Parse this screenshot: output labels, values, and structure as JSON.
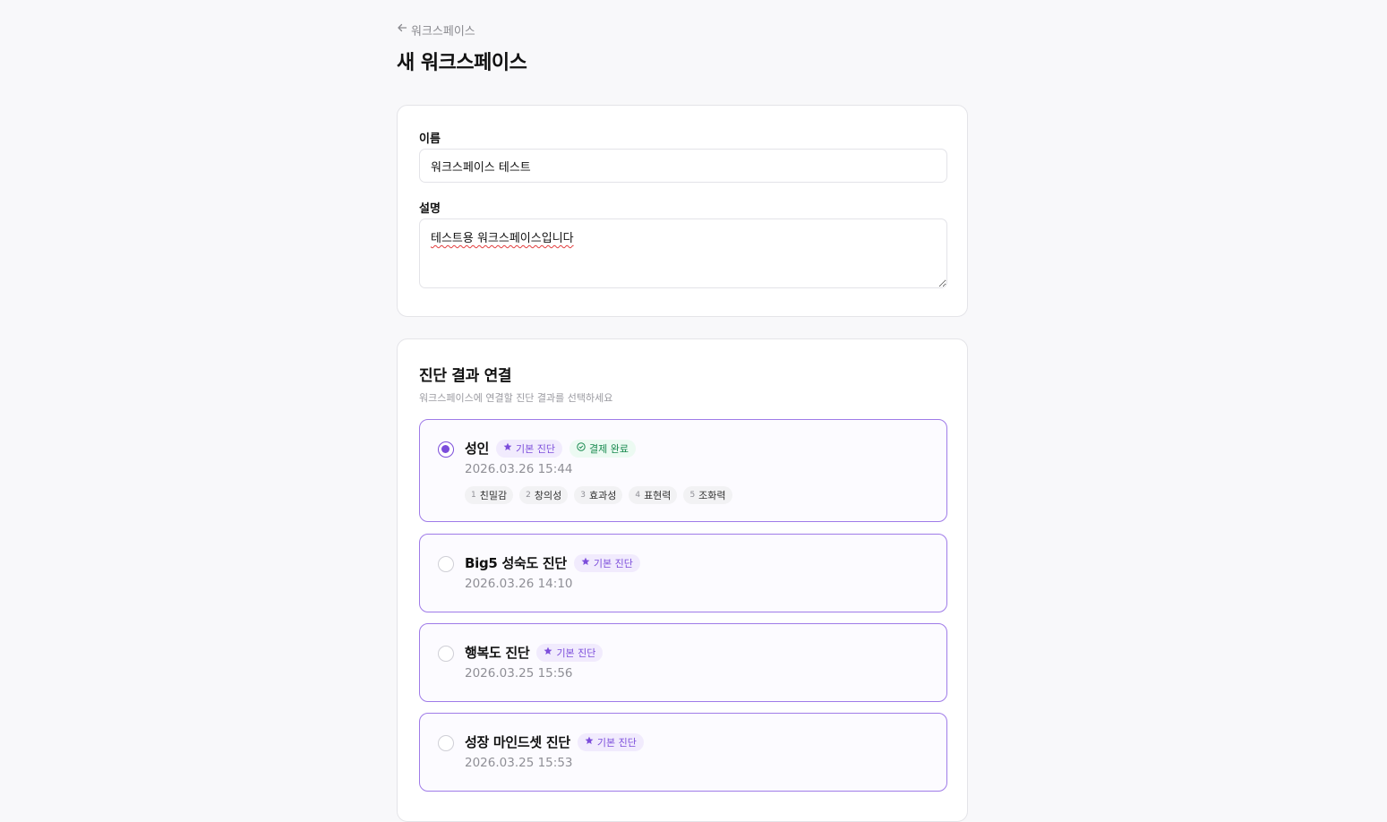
{
  "header": {
    "back_label": "워크스페이스",
    "title": "새 워크스페이스"
  },
  "form": {
    "name_label": "이름",
    "name_value": "워크스페이스 테스트",
    "description_label": "설명",
    "description_value": "테스트용 워크스페이스입니다"
  },
  "diagnosis": {
    "title": "진단 결과 연결",
    "subtitle": "워크스페이스에 연결할 진단 결과를 선택하세요",
    "options": [
      {
        "title": "성인",
        "badge_basic": "기본 진단",
        "badge_paid": "결제 완료",
        "date": "2026.03.26 15:44",
        "selected": true,
        "tags": [
          {
            "num": "1",
            "label": "친밀감"
          },
          {
            "num": "2",
            "label": "창의성"
          },
          {
            "num": "3",
            "label": "효과성"
          },
          {
            "num": "4",
            "label": "표현력"
          },
          {
            "num": "5",
            "label": "조화력"
          }
        ]
      },
      {
        "title": "Big5 성숙도 진단",
        "badge_basic": "기본 진단",
        "date": "2026.03.26 14:10",
        "selected": false
      },
      {
        "title": "행복도 진단",
        "badge_basic": "기본 진단",
        "date": "2026.03.25 15:56",
        "selected": false
      },
      {
        "title": "성장 마인드셋 진단",
        "badge_basic": "기본 진단",
        "date": "2026.03.25 15:53",
        "selected": false
      }
    ]
  },
  "colors": {
    "accent": "#7c4ddb",
    "accent_border": "#9f7be8",
    "success": "#17894e",
    "background": "#f8f8fa"
  },
  "icons": {
    "back": "arrow-left-icon",
    "basic_badge": "star-icon",
    "paid_badge": "check-circle-icon"
  }
}
